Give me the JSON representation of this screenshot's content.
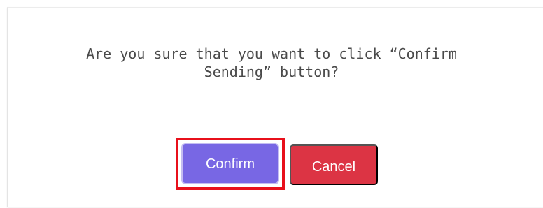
{
  "dialog": {
    "message_line1": "Are you sure that you want to click “Confirm",
    "message_line2": "Sending” button?",
    "confirm_label": "Confirm",
    "cancel_label": "Cancel"
  },
  "colors": {
    "confirm_button": "#7867e4",
    "cancel_button": "#dc3444",
    "highlight_border": "#e8101b"
  }
}
